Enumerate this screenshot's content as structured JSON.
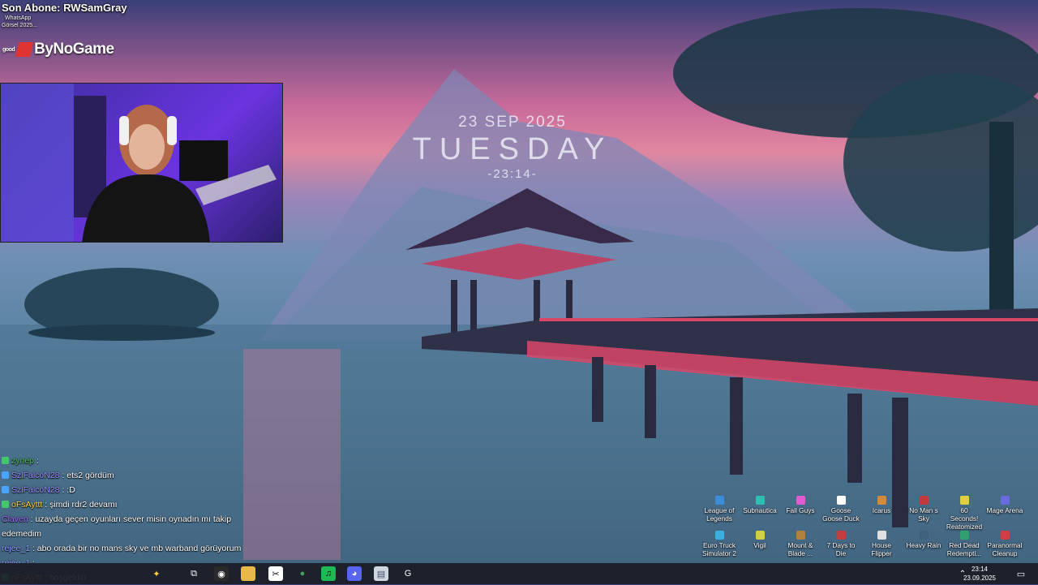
{
  "stream_overlay": {
    "subscriber": "Son Abone: RWSamGray",
    "tiny_line_1": "WhatsApp",
    "tiny_line_2": "Görsel 2025...",
    "tiny_good": "good",
    "logo_text": "ByNoGame"
  },
  "wallpaper_clock": {
    "date": "23 SEP 2025",
    "day": "TUESDAY",
    "time": "-23:14-"
  },
  "chat": [
    {
      "user": "zynep",
      "message": " : ",
      "user_color": "#4fbf4f",
      "badge": "#42c86a"
    },
    {
      "user": "SzlFalcoN28",
      "message": " : ets2 gördüm",
      "user_color": "#9b8cff",
      "badge": "#4aa3ff"
    },
    {
      "user": "SzlFalcoN28",
      "message": " : :D",
      "user_color": "#9b8cff",
      "badge": "#4aa3ff"
    },
    {
      "user": "oFsAyttt",
      "message": " : şimdi rdr2 devamı",
      "user_color": "#ffd34a",
      "badge": "#42c86a"
    },
    {
      "user": "Claven",
      "message": " : uzayda geçen oyunları sever misin oynadın mı takip",
      "user_color": "#a070ff",
      "badge": ""
    },
    {
      "user": "",
      "message": "edemedim",
      "user_color": "#ffffff",
      "badge": ""
    },
    {
      "user": "rejee_1",
      "message": " : abo orada bir no mans sky ve mb warband görüyorum",
      "user_color": "#8fa0ff",
      "badge": ""
    },
    {
      "user": "rejee_1",
      "message": " : ",
      "user_color": "#8fa0ff",
      "badge": ""
    },
    {
      "user": "oFsAyttt",
      "message": " : hoşgeldin",
      "user_color": "#ffd34a",
      "badge": "#42c86a"
    }
  ],
  "desktop_icons": [
    {
      "label": "League of Legends",
      "color": "#3a8dd6"
    },
    {
      "label": "Subnautica",
      "color": "#2fbfb0"
    },
    {
      "label": "Fall Guys",
      "color": "#e05ad0"
    },
    {
      "label": "Goose Goose Duck",
      "color": "#ffffff"
    },
    {
      "label": "Icarus",
      "color": "#d48a3a"
    },
    {
      "label": "No Man s Sky",
      "color": "#c03a3a"
    },
    {
      "label": "60 Seconds! Reatomized",
      "color": "#e0d040"
    },
    {
      "label": "Mage Arena",
      "color": "#6a6ae0"
    },
    {
      "label": "Euro Truck Simulator 2",
      "color": "#3ab0e0"
    },
    {
      "label": "Vigil",
      "color": "#d0d040"
    },
    {
      "label": "Mount & Blade ...",
      "color": "#b08040"
    },
    {
      "label": "7 Days to Die",
      "color": "#c04040"
    },
    {
      "label": "House Flipper",
      "color": "#e0e0e0"
    },
    {
      "label": "Heavy Rain",
      "color": "#406080"
    },
    {
      "label": "Red Dead Redempti...",
      "color": "#30a070"
    },
    {
      "label": "Paranormal Cleanup",
      "color": "#d04040"
    }
  ],
  "taskbar": {
    "apps": [
      {
        "name": "sparkle-widget-icon",
        "glyph": "✦",
        "bg": "transparent",
        "color": "#ffd34a"
      },
      {
        "name": "task-view-icon",
        "glyph": "⧉",
        "bg": "transparent",
        "color": "#ffffff"
      },
      {
        "name": "obs-icon",
        "glyph": "◉",
        "bg": "#2a2a2a",
        "color": "#ffffff"
      },
      {
        "name": "file-explorer-icon",
        "glyph": "▬",
        "bg": "#e8b84a",
        "color": "#e8b84a"
      },
      {
        "name": "capcut-icon",
        "glyph": "✂",
        "bg": "#ffffff",
        "color": "#111111"
      },
      {
        "name": "chrome-icon",
        "glyph": "●",
        "bg": "transparent",
        "color": "#46a35e"
      },
      {
        "name": "spotify-icon",
        "glyph": "♫",
        "bg": "#1db954",
        "color": "#000000"
      },
      {
        "name": "discord-icon",
        "glyph": "◕",
        "bg": "#5865f2",
        "color": "#ffffff"
      },
      {
        "name": "notepad-icon",
        "glyph": "▤",
        "bg": "#cfd6e0",
        "color": "#44506a"
      },
      {
        "name": "g-hub-icon",
        "glyph": "G",
        "bg": "transparent",
        "color": "#ffffff"
      }
    ],
    "time": "23:14",
    "date": "23.09.2025"
  }
}
